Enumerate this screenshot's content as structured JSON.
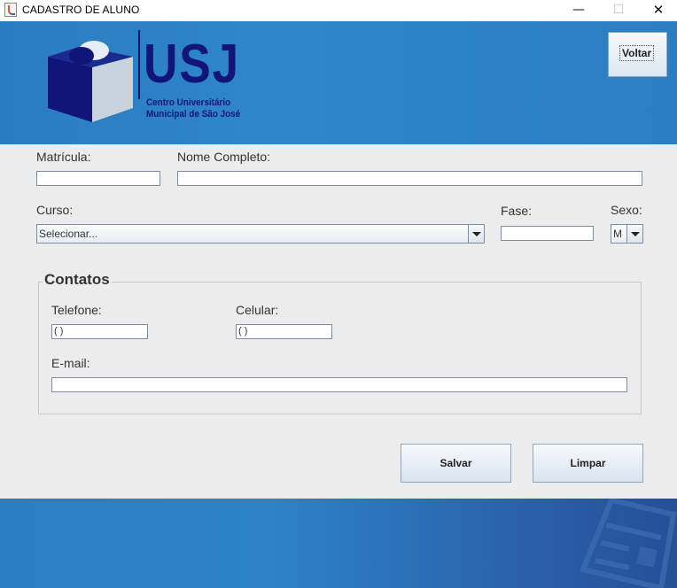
{
  "window": {
    "title": "CADASTRO DE ALUNO",
    "minimize_glyph": "—",
    "maximize_glyph": "☐",
    "close_glyph": "✕"
  },
  "header": {
    "logo_text": "USJ",
    "logo_subtitle_line1": "Centro Universitário",
    "logo_subtitle_line2": "Municipal de São José",
    "back_button": "Voltar",
    "colors": {
      "banner": "#2e86c8",
      "logo": "#11157a"
    }
  },
  "form": {
    "matricula_label": "Matrícula:",
    "matricula_value": "",
    "nome_label": "Nome Completo:",
    "nome_value": "",
    "curso_label": "Curso:",
    "curso_selected": "Selecionar...",
    "fase_label": "Fase:",
    "fase_value": "",
    "sexo_label": "Sexo:",
    "sexo_selected": "M"
  },
  "contatos": {
    "title": "Contatos",
    "telefone_label": "Telefone:",
    "telefone_value": "(  )",
    "celular_label": "Celular:",
    "celular_value": "(  )",
    "email_label": "E-mail:",
    "email_value": ""
  },
  "actions": {
    "save": "Salvar",
    "clear": "Limpar"
  }
}
